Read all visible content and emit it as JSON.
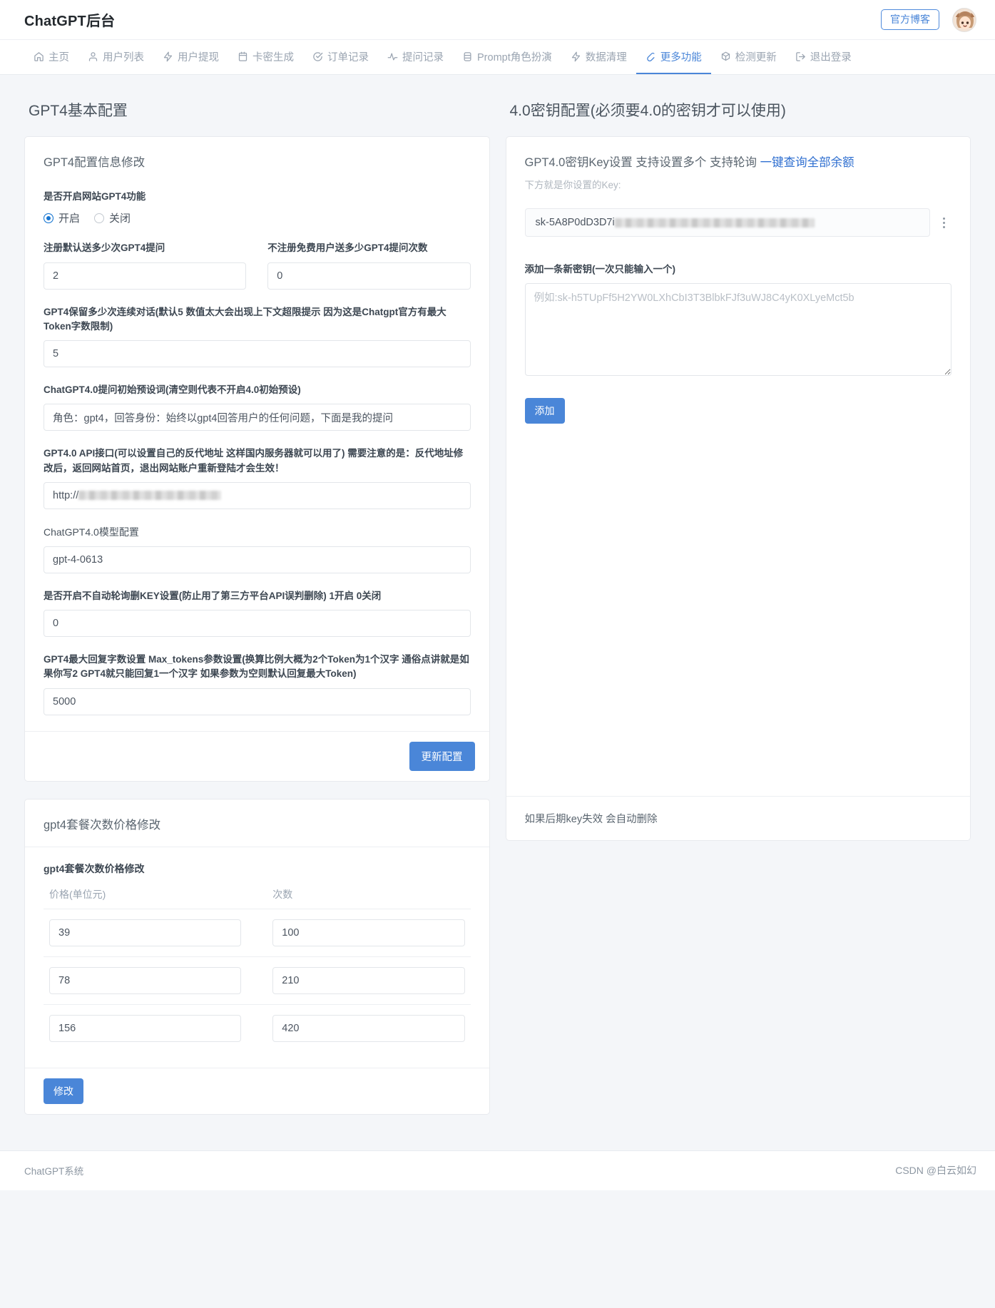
{
  "header": {
    "brand": "ChatGPT后台",
    "blog_button": "官方博客",
    "avatar_name": "user-avatar"
  },
  "nav": {
    "items": [
      {
        "label": "主页",
        "icon": "home-icon",
        "active": false
      },
      {
        "label": "用户列表",
        "icon": "user-icon",
        "active": false
      },
      {
        "label": "用户提现",
        "icon": "bolt-icon",
        "active": false
      },
      {
        "label": "卡密生成",
        "icon": "calendar-icon",
        "active": false
      },
      {
        "label": "订单记录",
        "icon": "check-circle-icon",
        "active": false
      },
      {
        "label": "提问记录",
        "icon": "activity-icon",
        "active": false
      },
      {
        "label": "Prompt角色扮演",
        "icon": "database-icon",
        "active": false
      },
      {
        "label": "数据清理",
        "icon": "bolt-icon",
        "active": false
      },
      {
        "label": "更多功能",
        "icon": "pen-icon",
        "active": true
      },
      {
        "label": "检测更新",
        "icon": "package-icon",
        "active": false
      },
      {
        "label": "退出登录",
        "icon": "logout-icon",
        "active": false
      }
    ]
  },
  "left": {
    "section_title": "GPT4基本配置",
    "card_title": "GPT4配置信息修改",
    "toggle": {
      "label": "是否开启网站GPT4功能",
      "options": [
        "开启",
        "关闭"
      ],
      "selected": "开启"
    },
    "fields": {
      "register_gift_label": "注册默认送多少次GPT4提问",
      "register_gift_value": "2",
      "free_gift_label": "不注册免费用户送多少GPT4提问次数",
      "free_gift_value": "0",
      "context_label": "GPT4保留多少次连续对话(默认5 数值太大会出现上下文超限提示 因为这是Chatgpt官方有最大Token字数限制)",
      "context_value": "5",
      "preset_label": "ChatGPT4.0提问初始预设词(清空则代表不开启4.0初始预设)",
      "preset_value": "角色：gpt4，回答身份：始终以gpt4回答用户的任何问题，下面是我的提问",
      "api_label": "GPT4.0 API接口(可以设置自己的反代地址 这样国内服务器就可以用了) 需要注意的是：反代地址修改后，返回网站首页，退出网站账户重新登陆才会生效！",
      "api_value_prefix": "http://",
      "model_label": "ChatGPT4.0模型配置",
      "model_value": "gpt-4-0613",
      "nopoll_label": "是否开启不自动轮询删KEY设置(防止用了第三方平台API误判删除) 1开启 0关闭",
      "nopoll_value": "0",
      "maxtokens_label": "GPT4最大回复字数设置 Max_tokens参数设置(换算比例大概为2个Token为1个汉字 通俗点讲就是如果你写2 GPT4就只能回复1一个汉字 如果参数为空则默认回复最大Token)",
      "maxtokens_value": "5000"
    },
    "update_button": "更新配置"
  },
  "right": {
    "section_title": "4.0密钥配置(必须要4.0的密钥才可以使用)",
    "card_title": "GPT4.0密钥Key设置 支持设置多个 支持轮询",
    "card_title_link": "一键查询全部余额",
    "card_sub": "下方就是你设置的Key:",
    "key_value_prefix": "sk-5A8P0dD3D7i",
    "add_label": "添加一条新密钥(一次只能输入一个)",
    "add_placeholder": "例如: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",
    "add_button": "添加",
    "footer_note": "如果后期key失效 会自动删除"
  },
  "package": {
    "card_title": "gpt4套餐次数价格修改",
    "sub_title": "gpt4套餐次数价格修改",
    "columns": [
      "价格(单位元)",
      "次数"
    ],
    "rows": [
      {
        "price": "39",
        "count": "100"
      },
      {
        "price": "78",
        "count": "210"
      },
      {
        "price": "156",
        "count": "420"
      }
    ],
    "modify_button": "修改"
  },
  "footer": {
    "left": "ChatGPT系统",
    "watermark": "CSDN @白云如幻"
  },
  "colors": {
    "accent": "#4a86d8",
    "link": "#2f6fd0",
    "page_bg": "#f4f6f9",
    "card_bg": "#ffffff",
    "text": "#3f4a54",
    "muted": "#9aa4b1"
  }
}
